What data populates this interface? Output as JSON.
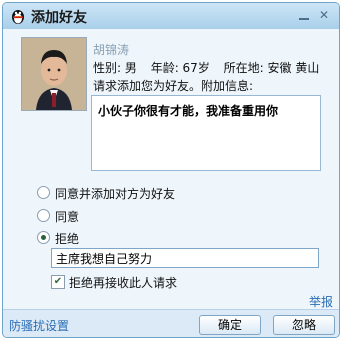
{
  "window": {
    "title": "添加好友",
    "app_icon": "qq-penguin-icon"
  },
  "requester": {
    "name": "胡锦涛",
    "gender": "性别: 男",
    "age": "年龄: 67岁",
    "location": "所在地: 安徽  黄山",
    "request_text": "请求添加您为好友。附加信息:",
    "message": "小伙子你很有才能，我准备重用你"
  },
  "options": {
    "agree_and_add": "同意并添加对方为好友",
    "agree": "同意",
    "reject": "拒绝",
    "selected": "reject",
    "reply_value": "主席我想自己努力",
    "block_label": "拒绝再接收此人请求",
    "block_checked": true
  },
  "links": {
    "report": "举报",
    "anti_harassment": "防骚扰设置"
  },
  "buttons": {
    "confirm": "确定",
    "ignore": "忽略"
  },
  "colors": {
    "titlebar": "#a9cfea",
    "link": "#2a6db5",
    "background": "#eef6fc"
  }
}
